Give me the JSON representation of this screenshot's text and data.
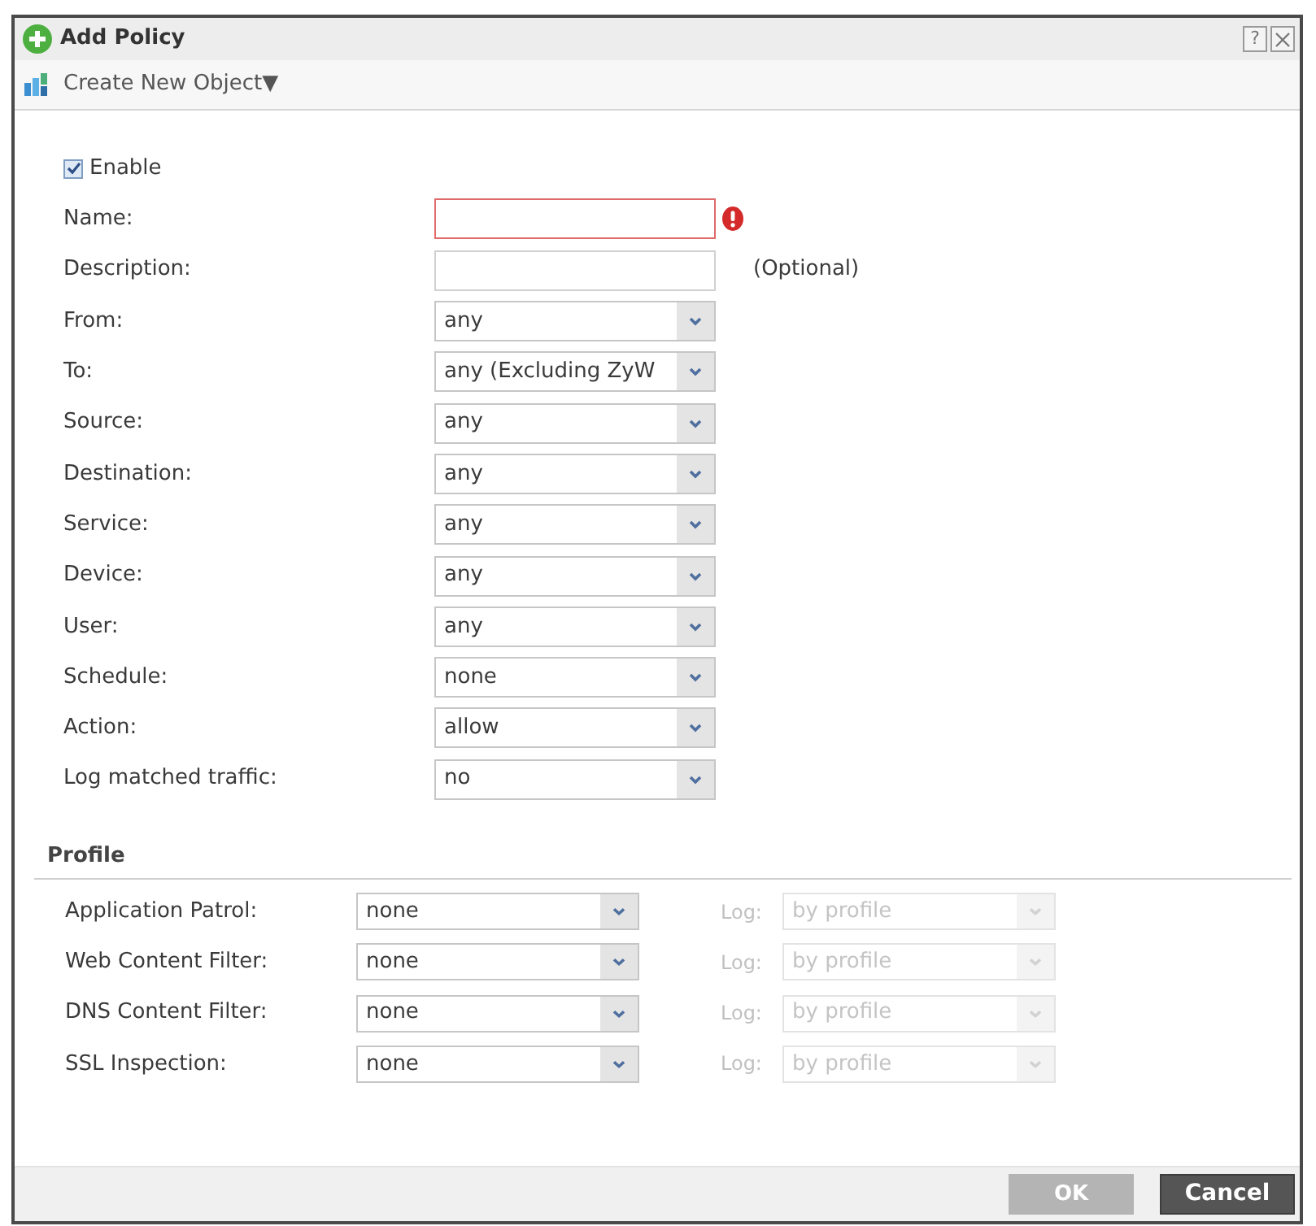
{
  "window": {
    "title": "Add Policy",
    "help_button": "?"
  },
  "toolbar": {
    "menu": {
      "label": "Create New Object",
      "caret": "▼"
    }
  },
  "form": {
    "enable": {
      "label": "Enable",
      "checked": true
    },
    "fields": [
      {
        "kind": "text",
        "label": "Name:",
        "invalid": true
      },
      {
        "kind": "text",
        "label": "Description:",
        "note": "(Optional)",
        "invalid": false
      },
      {
        "kind": "select",
        "label": "From:",
        "value": "any",
        "invalid": false
      },
      {
        "kind": "select",
        "label": "To:",
        "value": "any (Excluding ZyW",
        "invalid": false
      },
      {
        "kind": "select",
        "label": "Source:",
        "value": "any",
        "invalid": false
      },
      {
        "kind": "select",
        "label": "Destination:",
        "value": "any",
        "invalid": false
      },
      {
        "kind": "select",
        "label": "Service:",
        "value": "any",
        "invalid": false
      },
      {
        "kind": "select",
        "label": "Device:",
        "value": "any",
        "invalid": false
      },
      {
        "kind": "select",
        "label": "User:",
        "value": "any",
        "invalid": false
      },
      {
        "kind": "select",
        "label": "Schedule:",
        "value": "none",
        "invalid": false
      },
      {
        "kind": "select",
        "label": "Action:",
        "value": "allow",
        "invalid": false
      },
      {
        "kind": "select",
        "label": "Log matched traffic:",
        "value": "no",
        "invalid": false
      }
    ]
  },
  "profile": {
    "title": "Profile",
    "rows": [
      {
        "label": "Application Patrol:",
        "value": "none",
        "log_label": "Log:",
        "log_value": "by profile",
        "log_disabled": true
      },
      {
        "label": "Web Content Filter:",
        "value": "none",
        "log_label": "Log:",
        "log_value": "by profile",
        "log_disabled": true
      },
      {
        "label": "DNS Content Filter:",
        "value": "none",
        "log_label": "Log:",
        "log_value": "by profile",
        "log_disabled": true
      },
      {
        "label": "SSL Inspection:",
        "value": "none",
        "log_label": "Log:",
        "log_value": "by profile",
        "log_disabled": true
      }
    ]
  },
  "buttons": [
    {
      "label": "OK",
      "disabled": true
    },
    {
      "label": "Cancel",
      "disabled": false
    }
  ]
}
